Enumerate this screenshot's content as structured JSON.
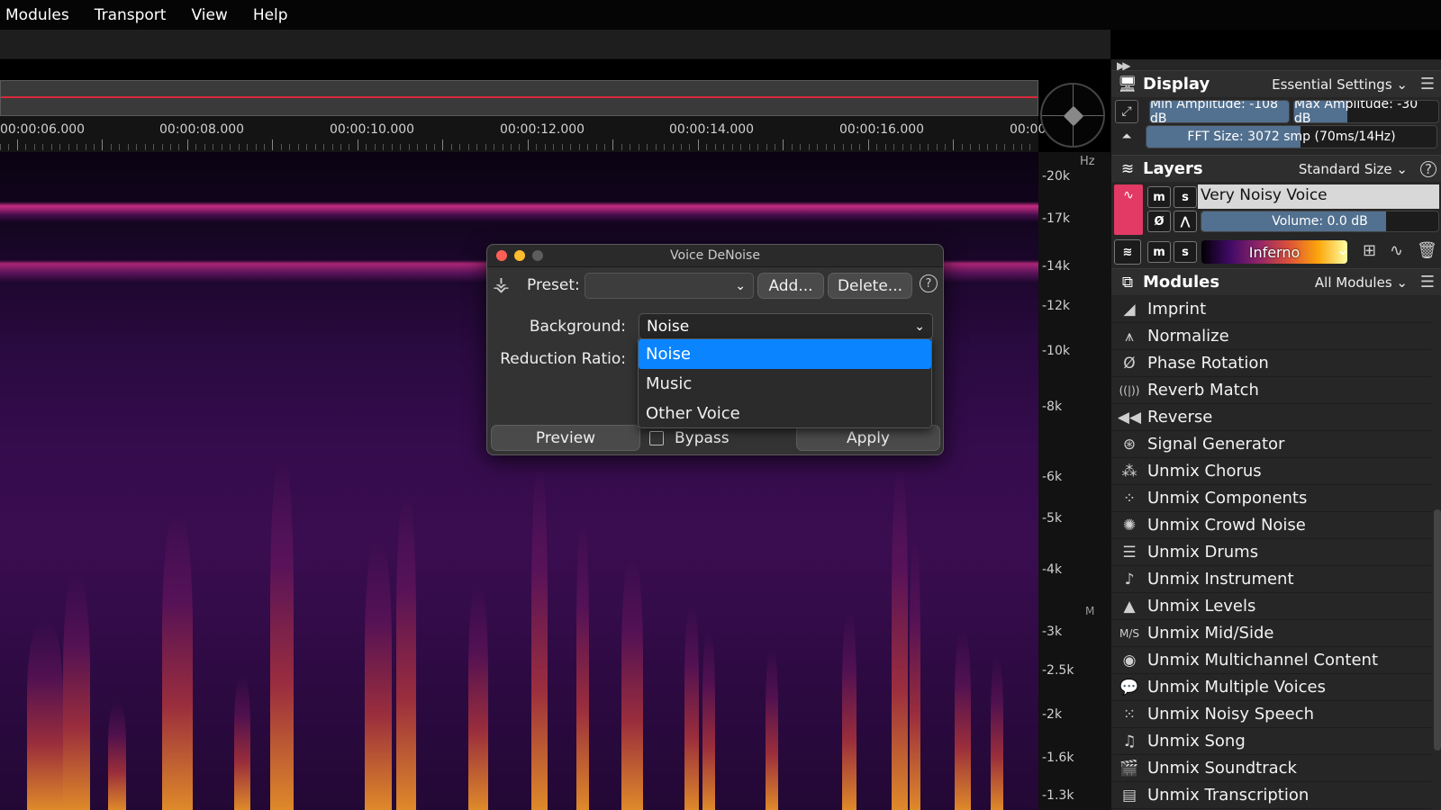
{
  "menu": [
    "Modules",
    "Transport",
    "View",
    "Help"
  ],
  "timeline": {
    "labels": [
      "00:00:06.000",
      "00:00:08.000",
      "00:00:10.000",
      "00:00:12.000",
      "00:00:14.000",
      "00:00:16.000",
      "00:00:"
    ]
  },
  "freq_axis": {
    "unit": "Hz",
    "labels": [
      "-20k",
      "-17k",
      "-14k",
      "-12k",
      "-10k",
      "-8k",
      "-6k",
      "-5k",
      "-4k",
      "-3k",
      "-2.5k",
      "-2k",
      "-1.6k",
      "-1.3k"
    ],
    "marker": "M"
  },
  "display": {
    "title": "Display",
    "dropdown": "Essential Settings",
    "min_amplitude": "Min Amplitude: -108 dB",
    "max_amplitude": "Max Amplitude: -30 dB",
    "fft_size": "FFT Size: 3072 smp (70ms/14Hz)"
  },
  "layers": {
    "title": "Layers",
    "dropdown": "Standard Size",
    "layer_name": "Very Noisy Voice",
    "volume": "Volume: 0.0 dB",
    "colormap": "Inferno",
    "mute_label": "m",
    "solo_label": "s"
  },
  "modules": {
    "title": "Modules",
    "dropdown": "All Modules",
    "items": [
      {
        "label": "Imprint",
        "icon": "imprint-icon",
        "glyph": "◢"
      },
      {
        "label": "Normalize",
        "icon": "normalize-icon",
        "glyph": "⩚"
      },
      {
        "label": "Phase Rotation",
        "icon": "phase-rotation-icon",
        "glyph": "Ø"
      },
      {
        "label": "Reverb Match",
        "icon": "reverb-match-icon",
        "glyph": "((|))"
      },
      {
        "label": "Reverse",
        "icon": "reverse-icon",
        "glyph": "◀◀"
      },
      {
        "label": "Signal Generator",
        "icon": "signal-generator-icon",
        "glyph": "⊛"
      },
      {
        "label": "Unmix Chorus",
        "icon": "unmix-chorus-icon",
        "glyph": "⁂"
      },
      {
        "label": "Unmix Components",
        "icon": "unmix-components-icon",
        "glyph": "⁘"
      },
      {
        "label": "Unmix Crowd Noise",
        "icon": "unmix-crowd-noise-icon",
        "glyph": "✺"
      },
      {
        "label": "Unmix Drums",
        "icon": "unmix-drums-icon",
        "glyph": "☰"
      },
      {
        "label": "Unmix Instrument",
        "icon": "unmix-instrument-icon",
        "glyph": "♪"
      },
      {
        "label": "Unmix Levels",
        "icon": "unmix-levels-icon",
        "glyph": "▲"
      },
      {
        "label": "Unmix Mid/Side",
        "icon": "unmix-mid-side-icon",
        "glyph": "M/S"
      },
      {
        "label": "Unmix Multichannel Content",
        "icon": "unmix-multichannel-icon",
        "glyph": "◉"
      },
      {
        "label": "Unmix Multiple Voices",
        "icon": "unmix-multiple-voices-icon",
        "glyph": "💬"
      },
      {
        "label": "Unmix Noisy Speech",
        "icon": "unmix-noisy-speech-icon",
        "glyph": "⁙"
      },
      {
        "label": "Unmix Song",
        "icon": "unmix-song-icon",
        "glyph": "♫"
      },
      {
        "label": "Unmix Soundtrack",
        "icon": "unmix-soundtrack-icon",
        "glyph": "🎬"
      },
      {
        "label": "Unmix Transcription",
        "icon": "unmix-transcription-icon",
        "glyph": "▤"
      }
    ]
  },
  "dialog": {
    "title": "Voice DeNoise",
    "preset_label": "Preset:",
    "preset_value": "",
    "add_button": "Add...",
    "delete_button": "Delete...",
    "help": "?",
    "background_label": "Background:",
    "background_value": "Noise",
    "background_options": [
      "Noise",
      "Music",
      "Other Voice"
    ],
    "background_selected": "Noise",
    "reduction_label": "Reduction Ratio:",
    "preview_button": "Preview",
    "bypass_label": "Bypass",
    "apply_button": "Apply"
  },
  "colors": {
    "accent_blue": "#0a84ff",
    "layer_color": "#e23a64",
    "playhead_red": "#d8283c"
  }
}
